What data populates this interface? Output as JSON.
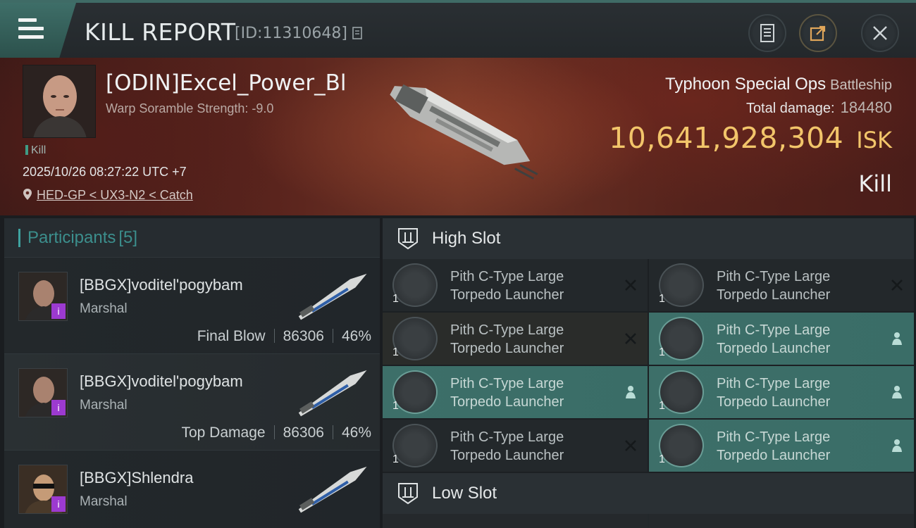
{
  "header": {
    "title": "KILL REPORT",
    "kill_id": "[ID:11310648]"
  },
  "victim": {
    "name": "[ODIN]Excel_Power_Bl",
    "warp_scramble": "Warp Soramble Strength: -9.0",
    "tag": "Kill",
    "datetime": "2025/10/26 08:27:22 UTC +7",
    "location": "HED-GP < UX3-N2 < Catch",
    "ship_name": "Typhoon Special Ops",
    "ship_class": "Battleship",
    "damage_label": "Total damage:",
    "damage_value": "184480",
    "isk_value": "10,641,928,304",
    "isk_unit": "ISK",
    "result": "Kill"
  },
  "participants": {
    "label": "Participants",
    "count": "[5]",
    "rows": [
      {
        "name": "[BBGX]voditel'pogybam",
        "role": "Marshal",
        "stat_label": "Final Blow",
        "damage": "86306",
        "percent": "46%",
        "badge": "i"
      },
      {
        "name": "[BBGX]voditel'pogybam",
        "role": "Marshal",
        "stat_label": "Top Damage",
        "damage": "86306",
        "percent": "46%",
        "badge": "i"
      },
      {
        "name": "[BBGX]Shlendra",
        "role": "Marshal",
        "stat_label": "",
        "damage": "",
        "percent": "",
        "badge": "i"
      }
    ]
  },
  "high_slot": {
    "title": "High Slot",
    "items": [
      {
        "name_line1": "Pith C-Type Large",
        "name_line2": "Torpedo Launcher",
        "qty": "1",
        "status": "destroyed-icon"
      },
      {
        "name_line1": "Pith C-Type Large",
        "name_line2": "Torpedo Launcher",
        "qty": "1",
        "status": "destroyed-icon"
      },
      {
        "name_line1": "Pith C-Type Large",
        "name_line2": "Torpedo Launcher",
        "qty": "1",
        "status": "destroyed-icon"
      },
      {
        "name_line1": "Pith C-Type Large",
        "name_line2": "Torpedo Launcher",
        "qty": "1",
        "status": "dropped-icon"
      },
      {
        "name_line1": "Pith C-Type Large",
        "name_line2": "Torpedo Launcher",
        "qty": "1",
        "status": "dropped-icon"
      },
      {
        "name_line1": "Pith C-Type Large",
        "name_line2": "Torpedo Launcher",
        "qty": "1",
        "status": "dropped-icon"
      },
      {
        "name_line1": "Pith C-Type Large",
        "name_line2": "Torpedo Launcher",
        "qty": "1",
        "status": "destroyed-icon"
      },
      {
        "name_line1": "Pith C-Type Large",
        "name_line2": "Torpedo Launcher",
        "qty": "1",
        "status": "dropped-icon"
      }
    ]
  },
  "low_slot": {
    "title": "Low Slot"
  },
  "colors": {
    "accent": "#3f6b66",
    "fitted_item": "#3d6f69",
    "isk_gold": "#f2c56a",
    "badge_purple": "#9c3ad0"
  }
}
